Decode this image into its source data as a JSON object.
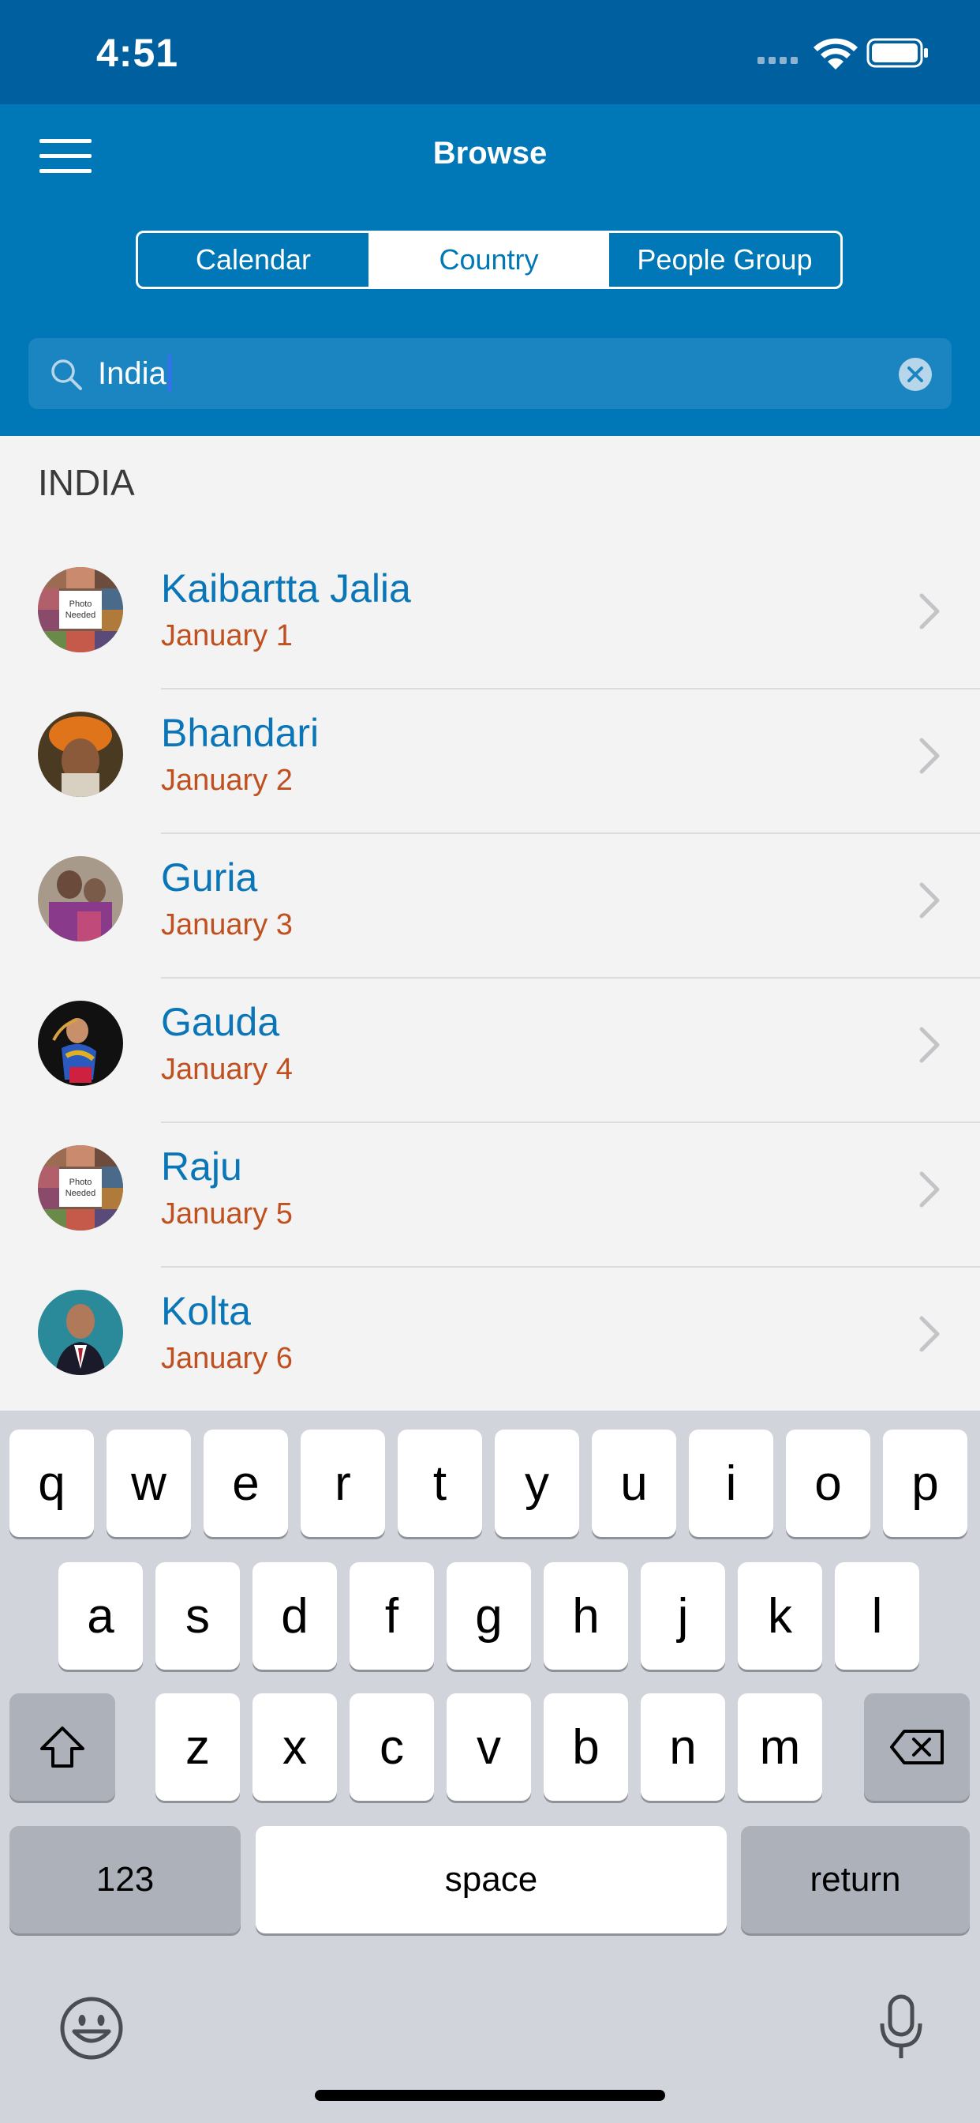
{
  "status_bar": {
    "time": "4:51"
  },
  "nav": {
    "title": "Browse",
    "menu_icon": "hamburger-menu-icon"
  },
  "segments": [
    {
      "label": "Calendar",
      "selected": false
    },
    {
      "label": "Country",
      "selected": true
    },
    {
      "label": "People Group",
      "selected": false
    }
  ],
  "search": {
    "value": "India"
  },
  "section": {
    "title": "INDIA"
  },
  "items": [
    {
      "name": "Kaibartta Jalia",
      "date": "January 1",
      "avatar": "photo-needed"
    },
    {
      "name": "Bhandari",
      "date": "January 2",
      "avatar": "photo"
    },
    {
      "name": "Guria",
      "date": "January 3",
      "avatar": "photo"
    },
    {
      "name": "Gauda",
      "date": "January 4",
      "avatar": "photo"
    },
    {
      "name": "Raju",
      "date": "January 5",
      "avatar": "photo-needed"
    },
    {
      "name": "Kolta",
      "date": "January 6",
      "avatar": "photo"
    }
  ],
  "avatar_placeholder": {
    "line1": "Photo",
    "line2": "Needed"
  },
  "keyboard": {
    "row1": [
      "q",
      "w",
      "e",
      "r",
      "t",
      "y",
      "u",
      "i",
      "o",
      "p"
    ],
    "row2": [
      "a",
      "s",
      "d",
      "f",
      "g",
      "h",
      "j",
      "k",
      "l"
    ],
    "row3": [
      "z",
      "x",
      "c",
      "v",
      "b",
      "n",
      "m"
    ],
    "numbers_label": "123",
    "space_label": "space",
    "return_label": "return"
  },
  "colors": {
    "nav_blue": "#0077b6",
    "status_blue": "#005f9e",
    "name_blue": "#0a76b8",
    "date_orange": "#c0501f"
  }
}
